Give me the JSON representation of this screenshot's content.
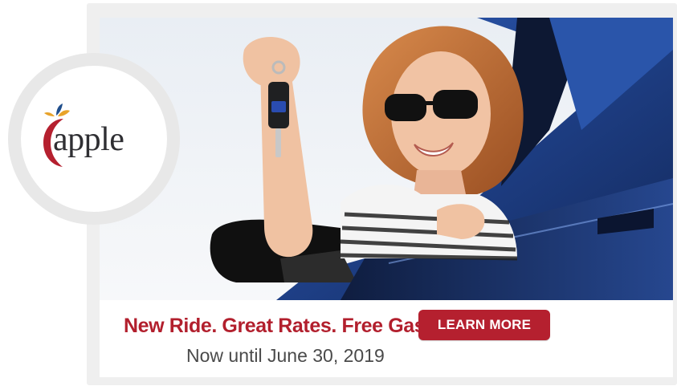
{
  "logo": {
    "word": "apple",
    "icon": "apple-logo-icon",
    "colors": {
      "red": "#b5202f",
      "blue": "#1f4e8c",
      "gold": "#e8a32a",
      "text": "#2f2f33"
    }
  },
  "banner": {
    "headline": "New Ride. Great Rates. Free Gas!*",
    "subline": "Now until June 30, 2019",
    "cta_label": "LEARN MORE",
    "colors": {
      "accent": "#b5202f",
      "subtext": "#4a4a4a",
      "car_blue": "#1e3f86"
    }
  }
}
